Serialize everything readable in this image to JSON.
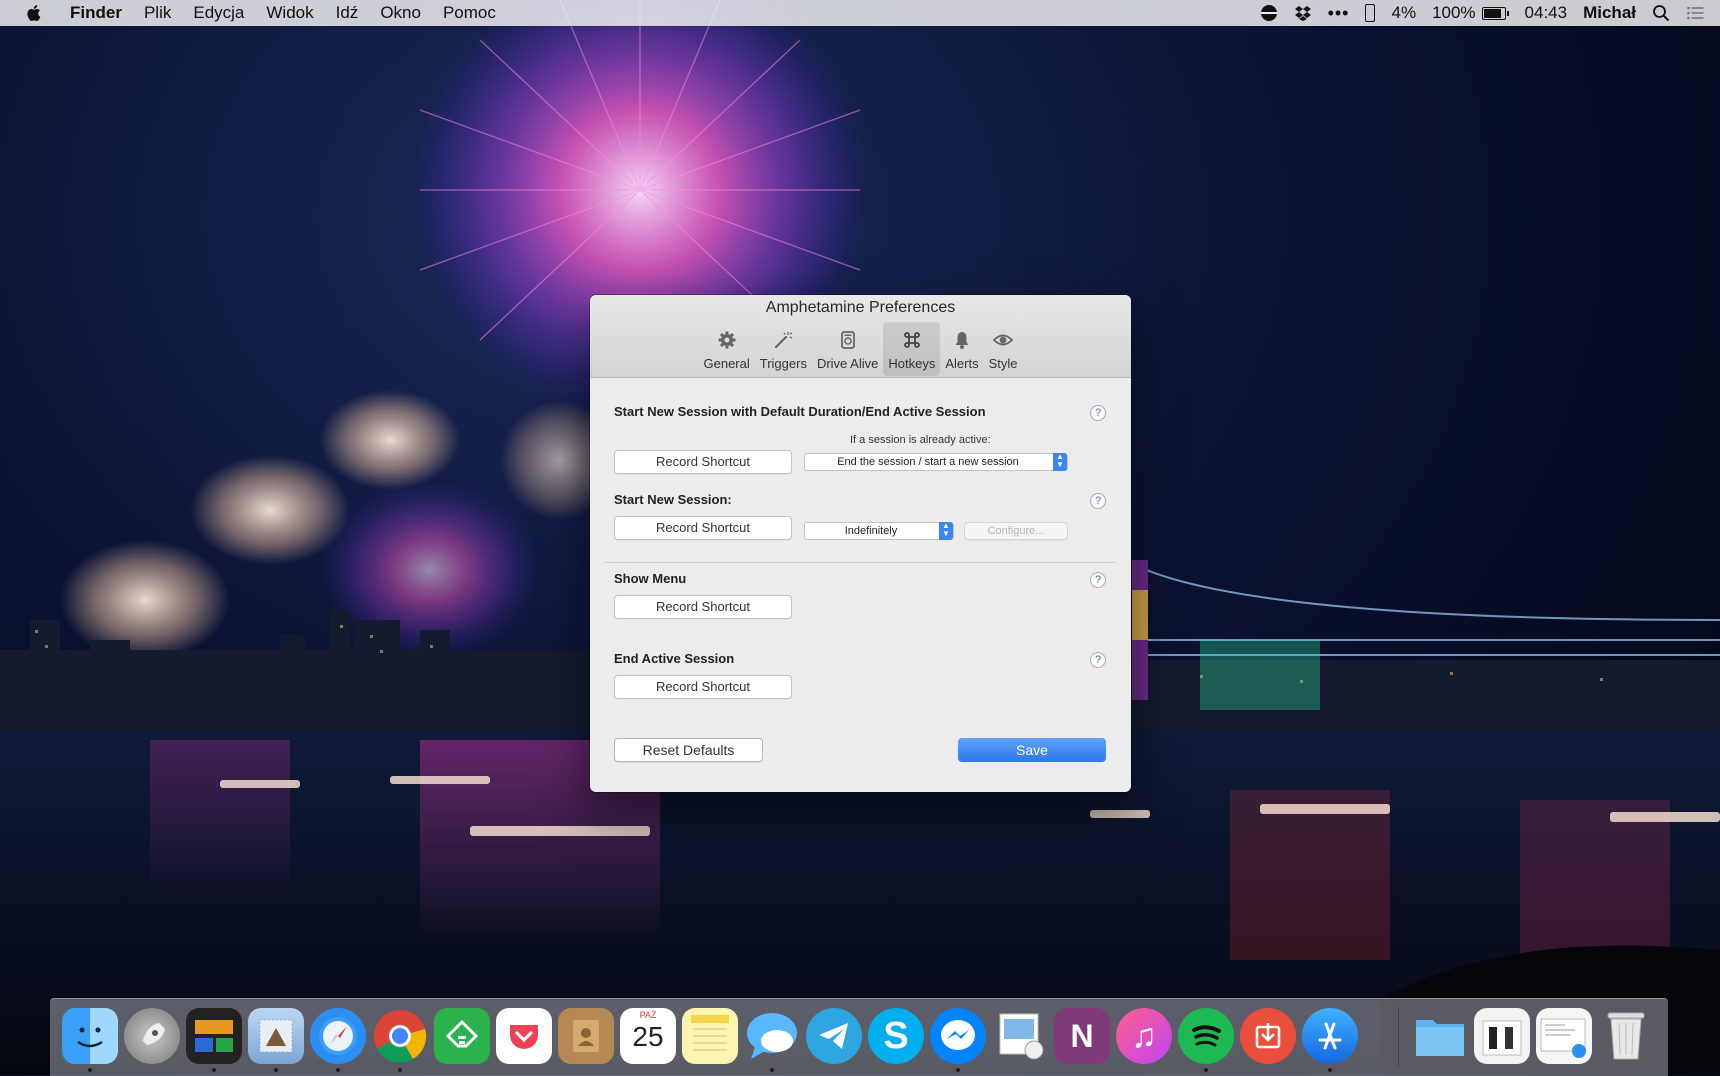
{
  "menubar": {
    "app_name": "Finder",
    "menus": [
      "Plik",
      "Edycja",
      "Widok",
      "Idź",
      "Okno",
      "Pomoc"
    ],
    "status": {
      "cpu_percent": "4%",
      "battery_percent": "100%",
      "battery_level": 1.0,
      "time": "04:43",
      "user": "Michał"
    }
  },
  "window": {
    "title": "Amphetamine Preferences",
    "tabs": [
      {
        "label": "General",
        "icon": "gear-icon"
      },
      {
        "label": "Triggers",
        "icon": "magic-wand-icon"
      },
      {
        "label": "Drive Alive",
        "icon": "drive-icon"
      },
      {
        "label": "Hotkeys",
        "icon": "command-icon",
        "active": true
      },
      {
        "label": "Alerts",
        "icon": "bell-icon"
      },
      {
        "label": "Style",
        "icon": "eye-icon"
      }
    ],
    "sections": [
      {
        "heading": "Start New Session with Default Duration/End Active Session",
        "button": "Record Shortcut",
        "option_label": "If a session is already active:",
        "select_value": "End the session / start a new session"
      },
      {
        "heading": "Start New Session:",
        "button": "Record Shortcut",
        "select_value": "Indefinitely",
        "configure_label": "Configure..."
      },
      {
        "heading": "Show Menu",
        "button": "Record Shortcut"
      },
      {
        "heading": "End Active Session",
        "button": "Record Shortcut"
      }
    ],
    "help_glyph": "?",
    "footer": {
      "reset_label": "Reset Defaults",
      "save_label": "Save"
    }
  },
  "dock": {
    "calendar_month": "PAŹ",
    "calendar_day": "25",
    "items": [
      "finder",
      "launchpad",
      "photo-booth",
      "mail",
      "safari",
      "chrome",
      "feedly",
      "pocket",
      "contacts",
      "calendar",
      "notes",
      "messages",
      "telegram",
      "skype",
      "messenger",
      "preview",
      "onenote",
      "itunes",
      "spotify",
      "transmit",
      "app-store"
    ]
  },
  "colors": {
    "accent": "#2b77ef",
    "window_bg": "#ececec"
  }
}
